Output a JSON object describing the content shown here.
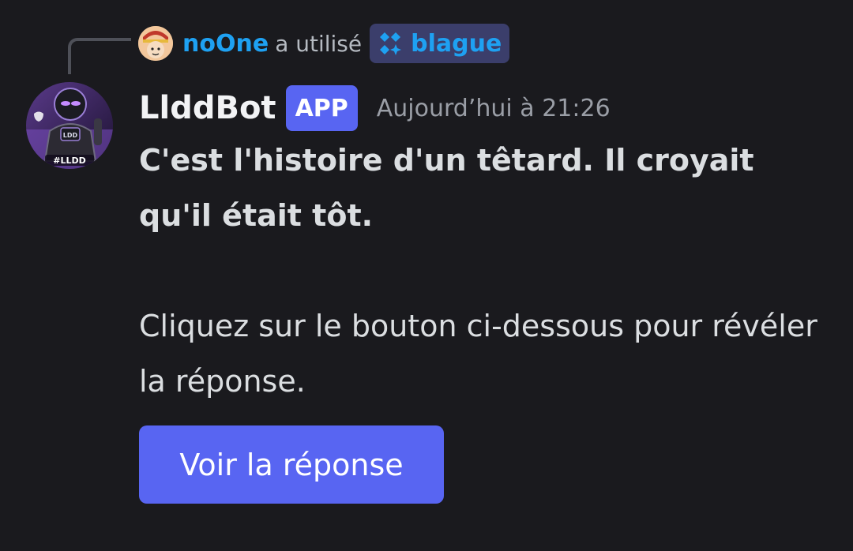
{
  "reference": {
    "user": "noOne",
    "action": "a utilisé",
    "command": "blague",
    "command_icon": "app-command-icon",
    "avatar_icon": "user-avatar"
  },
  "message": {
    "author": "LlddBot",
    "badge": "APP",
    "timestamp": "Aujourd’hui à 21:26",
    "avatar_icon": "bot-avatar",
    "avatar_text": "#LLDD",
    "joke": "C'est l'histoire d'un têtard. Il croyait qu'il était tôt.",
    "hint": "Cliquez sur le bouton ci-dessous pour révéler la réponse.",
    "button_label": "Voir la réponse"
  },
  "colors": {
    "background": "#1a1a1e",
    "username_blue": "#1ea1f2",
    "blurple": "#5865f2",
    "text": "#dbdee1",
    "muted": "#9a9ea6"
  }
}
